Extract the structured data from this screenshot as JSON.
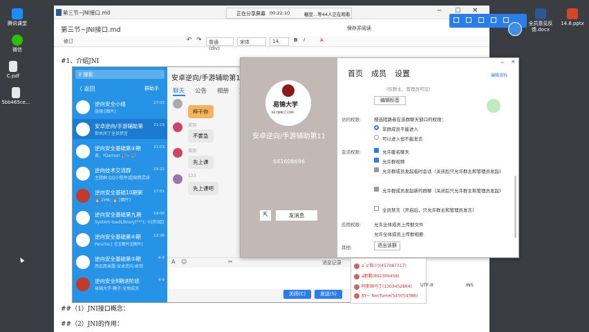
{
  "desktop": {
    "left_icons": [
      {
        "label": "腾讯课堂",
        "color": "#1a8cff"
      },
      {
        "label": "微信",
        "color": "#2dc100"
      },
      {
        "label": "C.pdf",
        "color": "#e8e8e8"
      },
      {
        "label": "5bb465ce...",
        "color": "#e8e8e8"
      }
    ],
    "right_icons": [
      {
        "label": "全员意见反馈.docx",
        "color": "#2b5797"
      },
      {
        "label": "14.8.pptx",
        "color": "#d24726"
      }
    ]
  },
  "share_banner": {
    "status": "正在分享屏幕",
    "time": "00:22:10",
    "viewers": "糖豆...等44人正在观看"
  },
  "editor": {
    "tab_title": "第三节~JNI接口.md",
    "doc_title": "第三节~JNI接口.md",
    "right_actions": [
      "保存并阅读",
      "⋯"
    ],
    "toolbar": {
      "revise": "修订",
      "style": "普通 (div)",
      "font": "宋体",
      "size": "14"
    },
    "lines": [
      {
        "text": "#1、介绍JNI"
      },
      {
        "text": "##（1）JNI接口概念："
      },
      {
        "text": "##（2）JNI的作用："
      }
    ]
  },
  "qq": {
    "search_placeholder": "搜索",
    "back": "〈 返回",
    "group_assistant": "群助手",
    "chat_title": "安卓逆向/手游辅助第11",
    "tabs": [
      "聊天",
      "公告",
      "相册",
      "文"
    ],
    "conversations": [
      {
        "name": "逆向安全小组",
        "sub": "张强:[图片]",
        "time": "17:03",
        "avatar": "#d2473b"
      },
      {
        "name": "安卓逆向/手游辅助第",
        "sub": "你关闭了全员禁言",
        "time": "21:19",
        "avatar": "#d2473b"
      },
      {
        "name": "逆向安全基础第②期",
        "sub": "君，*Demon 🎉~ 🎉",
        "time": "21:03",
        "avatar": "#2b6bb8"
      },
      {
        "name": "逆向技术交流群",
        "sub": "主题群:QQ小程序]超级精灵球",
        "time": "19:22",
        "avatar": "#2b6bb8"
      },
      {
        "name": "逆向安全基础10期第",
        "sub": "🔥 ZHK: 🔥 [图片]",
        "time": "17:01",
        "avatar": "#2b6bb8"
      },
      {
        "name": "逆向安全基础第九期",
        "sub": "System-loadLibrary(\"*\"); 小[你]组]",
        "time": "14:00",
        "avatar": "#2b6bb8"
      },
      {
        "name": "逆向安全基础第④期",
        "sub": "Pencho:[ 在][图片][图片]",
        "time": "12:36",
        "avatar": "#2b6bb8"
      },
      {
        "name": "逆向安全基础第⑤期",
        "sub": "西瓜西米露:安卓逆向.收到",
        "time": "4-9",
        "avatar": "#2b6bb8"
      },
      {
        "name": "逆向安全8期进阶班",
        "sub": "易锦大学-糖子:全体成员",
        "time": "4-9",
        "avatar": "#2b6bb8"
      }
    ],
    "messages": [
      {
        "user": "",
        "text": "梓千你"
      },
      {
        "user": "岚羽",
        "text": "不要急"
      },
      {
        "user": "岚羽",
        "text": "先上课"
      },
      {
        "user": "123",
        "text": "先上课吧"
      }
    ],
    "history": "消息记录",
    "close_btn": "关闭(C)",
    "send_btn": "发送(S)"
  },
  "dialog": {
    "nav": [
      "首页",
      "成员",
      "设置"
    ],
    "edit_profile": "编辑资料",
    "logo_text": "易锦大学",
    "logo_url": "KE.YIJINCC.COM",
    "group_name": "安卓逆向/手游辅助第11",
    "group_id": "641608696",
    "send_msg": "发消息",
    "top_partial": "(仅群主、管理员可见)",
    "edit_tags": "编辑标签",
    "visitor_label": "访问权限:",
    "visitor_intro": "搜选陌路者在该群聊天窗口的权限：",
    "visitor_opts": [
      "非群成员不能进入",
      "可以进入但不能发言"
    ],
    "session_label": "会话权限:",
    "session_opts": [
      {
        "text": "允许匿名聊天",
        "on": true
      },
      {
        "text": "允许群视频",
        "on": true
      },
      {
        "text": "允许群成员发起临时会话（关闭后只允许群主和管理员发起)",
        "on": true
      },
      {
        "text": "允许群成员发起新的群聊（关闭后只允许群主和管理员发起)",
        "on": true
      },
      {
        "text": "全员禁言（开启后，只允许群主和管理员发言）",
        "on": false
      }
    ],
    "app_label": "应用权限:",
    "app_opts": [
      "允许全体成员上传群文件",
      "允许全体成员上传群相册"
    ],
    "other_label": "其他:",
    "leave_btn": "退出该群"
  },
  "members": [
    {
      "name": "a`s'阳少)",
      "id": "(457087317)"
    },
    {
      "name": "a耐鹏",
      "id": "(892399458)"
    },
    {
      "name": "阿斯顿马丁",
      "id": "(1303452864)"
    },
    {
      "name": "BY~ NocTurne",
      "id": "(545054386)"
    }
  ],
  "status_bar": {
    "encoding": "UTF-8",
    "mode": "INS"
  }
}
